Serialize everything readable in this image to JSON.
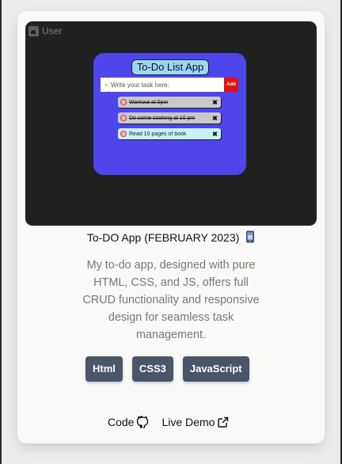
{
  "preview": {
    "user_label": "User",
    "app": {
      "title": "To-Do List App",
      "input_placeholder": "Write your task here:",
      "add_label": "Add",
      "tasks": [
        {
          "text": "Workout at 5pm",
          "done": true
        },
        {
          "text": "Do some cooking at 10 pm",
          "done": true
        },
        {
          "text": "Read 10 pages of book",
          "done": false
        }
      ],
      "delete_symbol": "✖"
    }
  },
  "project": {
    "title": "To-DO App (FEBRUARY 2023)",
    "description": "My to-do app, designed with pure HTML, CSS, and JS, offers full CRUD functionality and responsive design for seamless task management.",
    "tags": [
      "Html",
      "CSS3",
      "JavaScript"
    ],
    "links": {
      "code_label": "Code",
      "demo_label": "Live Demo"
    }
  },
  "colors": {
    "card_bg": "#f9f9f8",
    "preview_bg": "#202120",
    "app_bg": "#4e45eb",
    "tag_bg": "#4a5568",
    "add_button": "#e01111"
  },
  "icons": [
    "user-icon",
    "hand-pointing-icon",
    "delete-icon",
    "phone-icon",
    "github-icon",
    "external-link-icon"
  ]
}
